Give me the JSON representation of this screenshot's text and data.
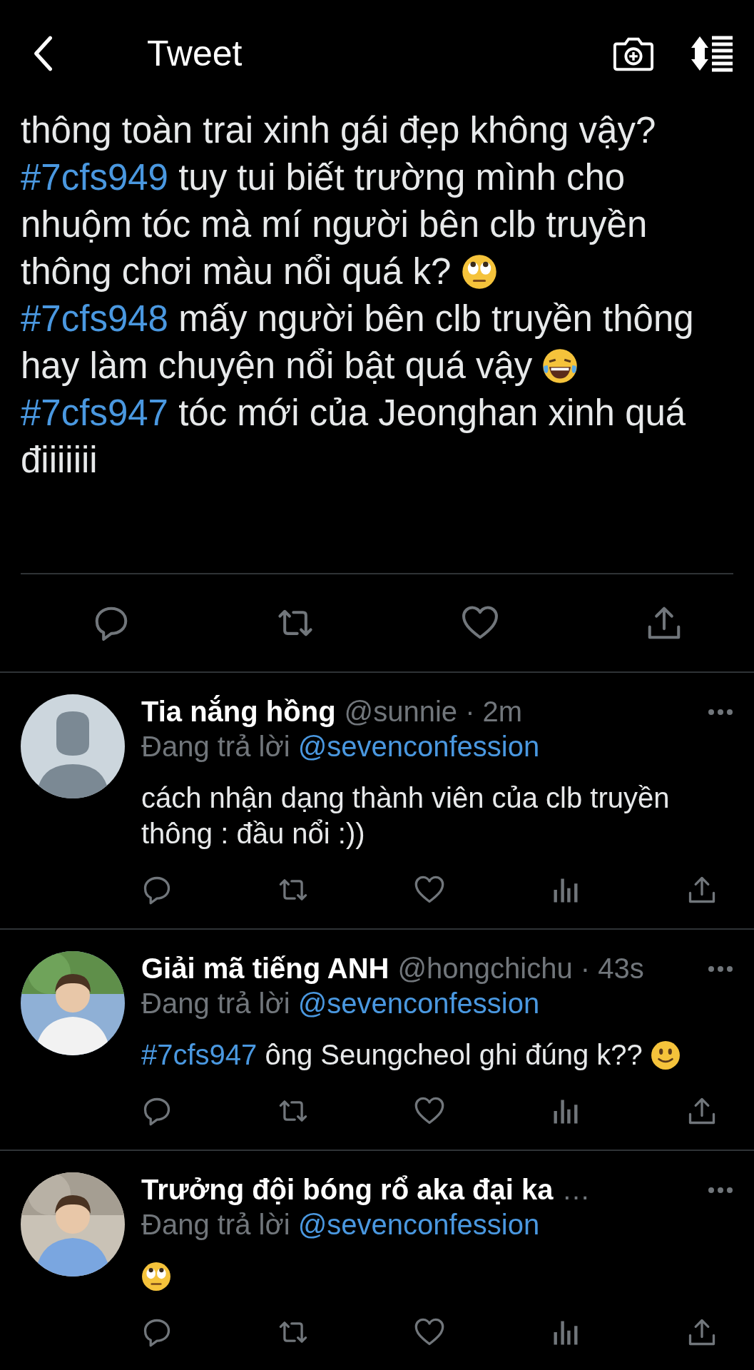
{
  "header": {
    "title": "Tweet"
  },
  "tweet": {
    "paragraphs": [
      {
        "text": "thông toàn trai xinh gái đẹp không vậy?"
      },
      {
        "tag": "#7cfs949",
        "text": "tuy tui biết trường mình cho nhuộm tóc mà mí người bên clb truyền thông chơi màu nổi quá k?",
        "emoji": {
          "kind": "rolling-eyes"
        }
      },
      {
        "tag": "#7cfs948",
        "text": "mấy người bên clb truyền thông hay làm chuyện nổi bật quá vậy",
        "emoji": {
          "kind": "laughing"
        }
      },
      {
        "tag": "#7cfs947",
        "text": "tóc mới của Jeonghan xinh quá điiiiiii"
      }
    ]
  },
  "replies": [
    {
      "name": "Tia nắng hồng",
      "meta": "@sunnie · 2m",
      "reply_prefix": "Đang trả lời",
      "mention": "@sevenconfession",
      "avatar": {
        "kind": "default"
      },
      "text": "cách nhận dạng thành viên của clb truyền thông : đầu nổi :))"
    },
    {
      "name": "Giải mã tiếng ANH",
      "meta": "@hongchichu · 43s",
      "reply_prefix": "Đang trả lời",
      "mention": "@sevenconfession",
      "tag": "#7cfs947",
      "text": "ông Seungcheol ghi đúng k??",
      "emoji": {
        "kind": "smile"
      }
    },
    {
      "name": "Trưởng đội bóng rổ aka đại ka",
      "meta": "…",
      "reply_prefix": "Đang trả lời",
      "mention": "@sevenconfession",
      "emoji": {
        "kind": "rolling-eyes"
      }
    }
  ]
}
